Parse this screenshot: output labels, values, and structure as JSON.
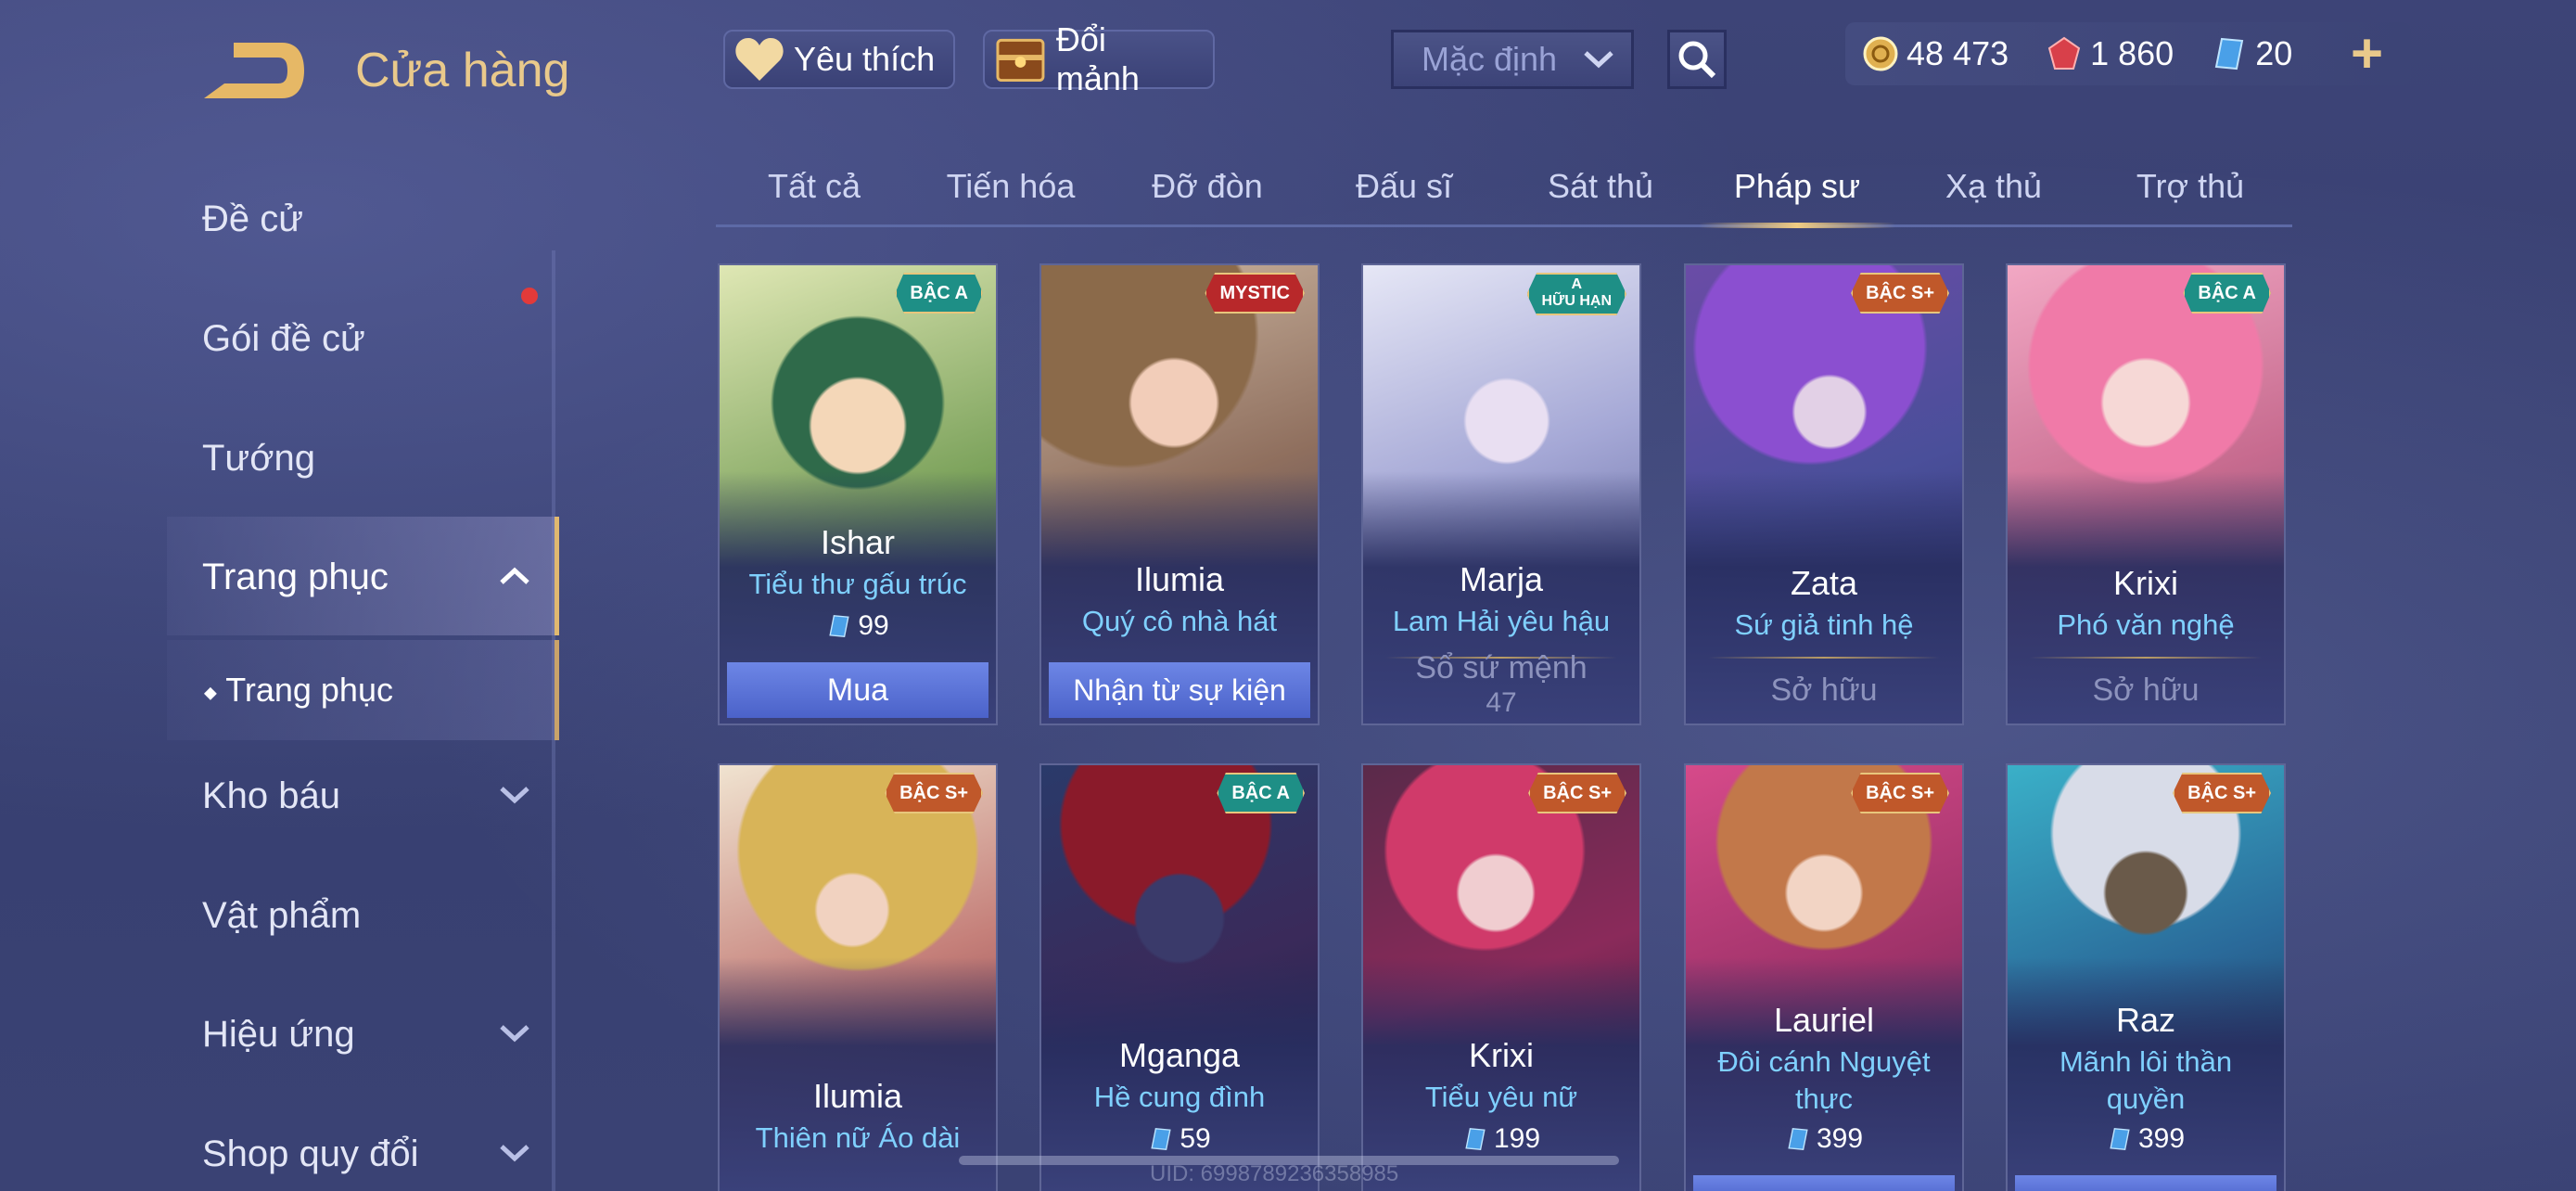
{
  "header": {
    "title": "Cửa hàng"
  },
  "toolbar": {
    "favorite_label": "Yêu thích",
    "exchange_label": "Đổi mảnh",
    "sort_value": "Mặc định"
  },
  "currency": {
    "gold": "48 473",
    "gems": "1 860",
    "vouchers": "20"
  },
  "sidebar": {
    "items": [
      {
        "label": "Đề cử"
      },
      {
        "label": "Gói đề cử"
      },
      {
        "label": "Tướng"
      },
      {
        "label": "Trang phục"
      },
      {
        "label": "Trang phục"
      },
      {
        "label": "Kho báu"
      },
      {
        "label": "Vật phẩm"
      },
      {
        "label": "Hiệu ứng"
      },
      {
        "label": "Shop quy đổi"
      }
    ]
  },
  "tabs": [
    {
      "label": "Tất cả"
    },
    {
      "label": "Tiến hóa"
    },
    {
      "label": "Đỡ đòn"
    },
    {
      "label": "Đấu sĩ"
    },
    {
      "label": "Sát thủ"
    },
    {
      "label": "Pháp sư"
    },
    {
      "label": "Xạ thủ"
    },
    {
      "label": "Trợ thủ"
    }
  ],
  "cards": [
    {
      "hero": "Ishar",
      "skin": "Tiểu thư gấu trúc",
      "badge": "BẬC A",
      "price": "99",
      "action": "Mua"
    },
    {
      "hero": "Ilumia",
      "skin": "Quý cô nhà hát",
      "badge": "MYSTIC",
      "action": "Nhận từ sự kiện"
    },
    {
      "hero": "Marja",
      "skin": "Lam Hải yêu hậu",
      "badge": "A",
      "badge_sub": "HỮU HẠN",
      "action": "Sổ sứ mệnh",
      "action_sub": "47"
    },
    {
      "hero": "Zata",
      "skin": "Sứ giả tinh hệ",
      "badge": "BẬC S+",
      "action": "Sở hữu"
    },
    {
      "hero": "Krixi",
      "skin": "Phó văn nghệ",
      "badge": "BẬC A",
      "action": "Sở hữu"
    },
    {
      "hero": "Ilumia",
      "skin": "Thiên nữ Áo dài",
      "badge": "BẬC S+"
    },
    {
      "hero": "Mganga",
      "skin": "Hề cung đình",
      "badge": "BẬC A",
      "price": "59"
    },
    {
      "hero": "Krixi",
      "skin": "Tiểu yêu nữ",
      "badge": "BẬC S+",
      "price": "199"
    },
    {
      "hero": "Lauriel",
      "skin": "Đôi cánh Nguyệt",
      "skin2": "thực",
      "badge": "BẬC S+",
      "price": "399"
    },
    {
      "hero": "Raz",
      "skin": "Mãnh lôi thần",
      "skin2": "quyền",
      "badge": "BẬC S+",
      "price": "399"
    }
  ],
  "footer": {
    "uid": "UID: 6998789236358985"
  },
  "colors": {
    "accent_gold": "#e9c98b",
    "skin_name_blue": "#7fd0ff",
    "buy_button": "#5b73d8"
  }
}
